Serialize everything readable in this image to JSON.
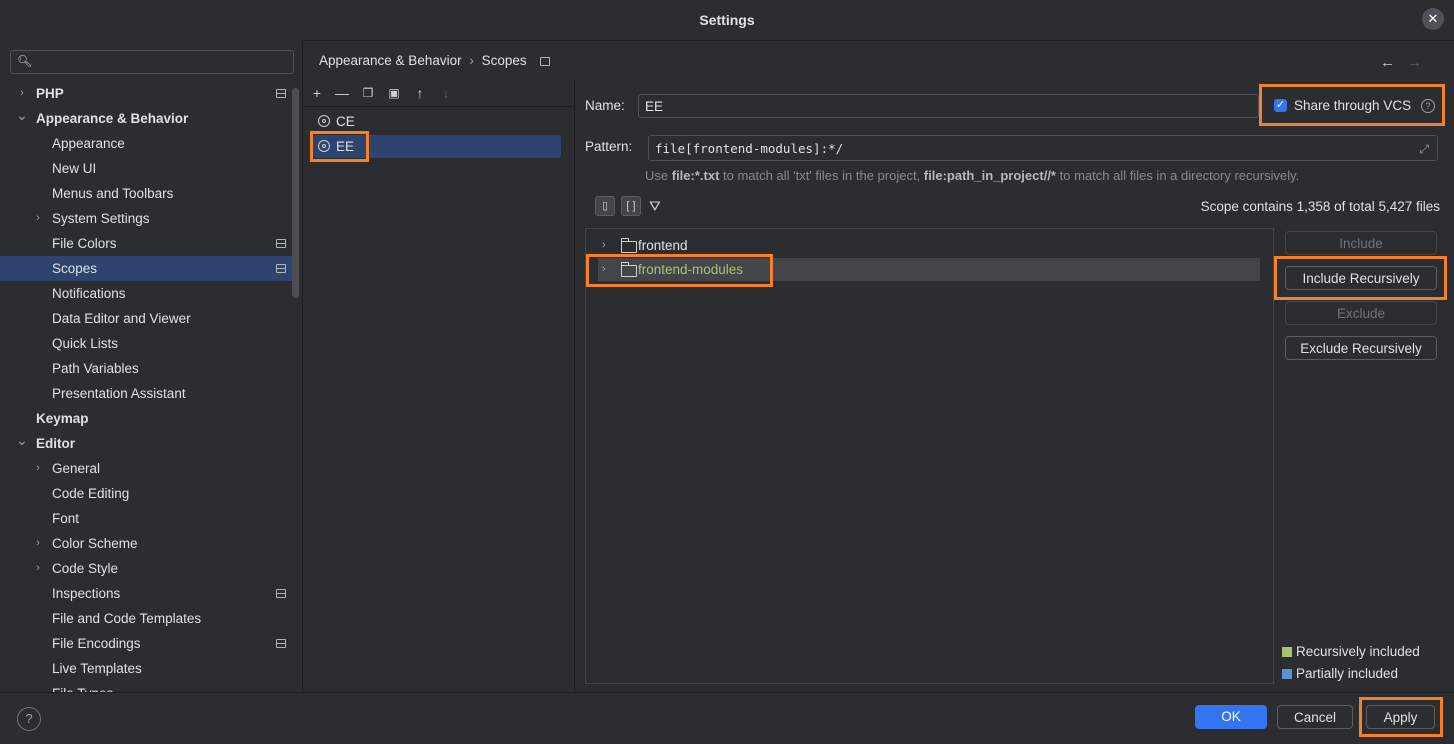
{
  "window": {
    "title": "Settings"
  },
  "search": {
    "placeholder": ""
  },
  "sidebar": {
    "items": [
      {
        "label": "PHP",
        "level": 0,
        "chevron": "right",
        "badge": true
      },
      {
        "label": "Appearance & Behavior",
        "level": 0,
        "chevron": "down"
      },
      {
        "label": "Appearance",
        "level": 1
      },
      {
        "label": "New UI",
        "level": 1
      },
      {
        "label": "Menus and Toolbars",
        "level": 1
      },
      {
        "label": "System Settings",
        "level": 1,
        "chevron": "right"
      },
      {
        "label": "File Colors",
        "level": 1,
        "badge": true
      },
      {
        "label": "Scopes",
        "level": 1,
        "badge": true,
        "selected": true
      },
      {
        "label": "Notifications",
        "level": 1
      },
      {
        "label": "Data Editor and Viewer",
        "level": 1
      },
      {
        "label": "Quick Lists",
        "level": 1
      },
      {
        "label": "Path Variables",
        "level": 1
      },
      {
        "label": "Presentation Assistant",
        "level": 1
      },
      {
        "label": "Keymap",
        "level": 0
      },
      {
        "label": "Editor",
        "level": 0,
        "chevron": "down"
      },
      {
        "label": "General",
        "level": 1,
        "chevron": "right"
      },
      {
        "label": "Code Editing",
        "level": 1
      },
      {
        "label": "Font",
        "level": 1
      },
      {
        "label": "Color Scheme",
        "level": 1,
        "chevron": "right"
      },
      {
        "label": "Code Style",
        "level": 1,
        "chevron": "right"
      },
      {
        "label": "Inspections",
        "level": 1,
        "badge": true
      },
      {
        "label": "File and Code Templates",
        "level": 1
      },
      {
        "label": "File Encodings",
        "level": 1,
        "badge": true
      },
      {
        "label": "Live Templates",
        "level": 1
      },
      {
        "label": "File Types",
        "level": 1
      }
    ]
  },
  "breadcrumb": {
    "parent": "Appearance & Behavior",
    "separator": "›",
    "current": "Scopes"
  },
  "toolbar_icons": [
    "add-icon",
    "remove-icon",
    "copy-icon",
    "save-icon",
    "move-up-icon",
    "move-down-icon"
  ],
  "scopes": [
    {
      "name": "CE",
      "selected": false
    },
    {
      "name": "EE",
      "selected": true
    }
  ],
  "form": {
    "name_label": "Name:",
    "name_value": "EE",
    "share_label": "Share through VCS",
    "share_checked": true,
    "pattern_label": "Pattern:",
    "pattern_value": "file[frontend-modules]:*/",
    "hint": {
      "p1": "Use ",
      "b1": "file:*.txt",
      "p2": " to match all 'txt' files in the project, ",
      "b2": "file:path_in_project//*",
      "p3": " to match all files in a directory recursively."
    },
    "scope_count": "Scope contains 1,358 of total 5,427 files"
  },
  "files": [
    {
      "name": "frontend",
      "included": false
    },
    {
      "name": "frontend-modules",
      "included": true,
      "selected": true
    }
  ],
  "side_buttons": {
    "include": "Include",
    "include_recursively": "Include Recursively",
    "exclude": "Exclude",
    "exclude_recursively": "Exclude Recursively"
  },
  "legend": {
    "recursive": {
      "label": "Recursively included",
      "color": "#a9c46e"
    },
    "partial": {
      "label": "Partially included",
      "color": "#5c8fd6"
    }
  },
  "footer": {
    "help": "?",
    "ok": "OK",
    "cancel": "Cancel",
    "apply": "Apply"
  },
  "colors": {
    "accent": "#3574f0",
    "selection": "#2e436e",
    "highlight": "#f5822a"
  }
}
